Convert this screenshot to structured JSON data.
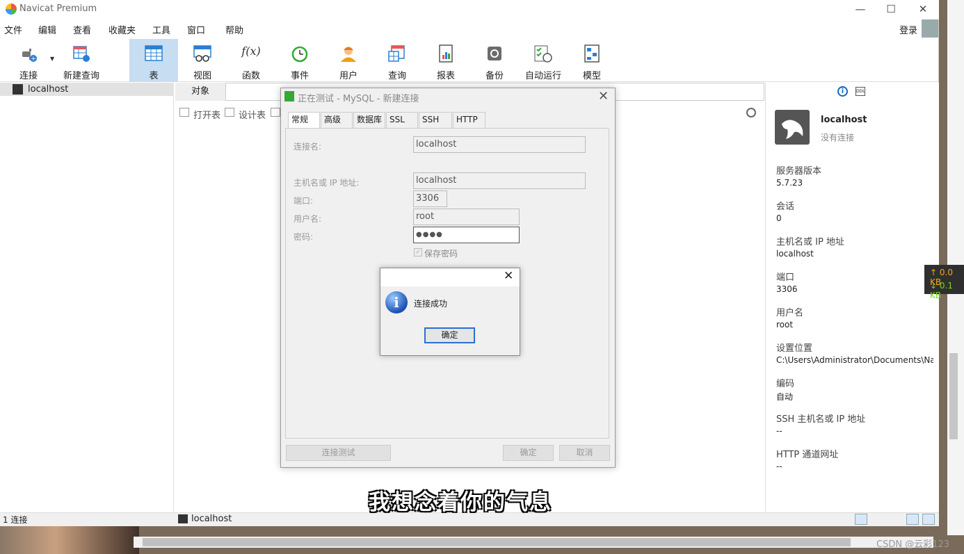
{
  "app": {
    "title": "Navicat Premium",
    "login": "登录"
  },
  "window_controls": {
    "minimize": "—",
    "maximize": "☐",
    "close": "✕"
  },
  "menu": [
    "文件",
    "编辑",
    "查看",
    "收藏夹",
    "工具",
    "窗口",
    "帮助"
  ],
  "toolbar": [
    {
      "label": "连接",
      "icon": "plug-icon"
    },
    {
      "label": "新建查询",
      "icon": "new-query-icon"
    },
    {
      "label": "表",
      "icon": "table-icon",
      "active": true
    },
    {
      "label": "视图",
      "icon": "view-icon"
    },
    {
      "label": "函数",
      "icon": "function-icon",
      "glyph": "f(x)"
    },
    {
      "label": "事件",
      "icon": "clock-icon"
    },
    {
      "label": "用户",
      "icon": "user-icon"
    },
    {
      "label": "查询",
      "icon": "query-icon"
    },
    {
      "label": "报表",
      "icon": "report-icon"
    },
    {
      "label": "备份",
      "icon": "backup-icon"
    },
    {
      "label": "自动运行",
      "icon": "schedule-icon"
    },
    {
      "label": "模型",
      "icon": "model-icon"
    }
  ],
  "tree": {
    "connection": "localhost"
  },
  "center": {
    "tab": "对象",
    "subtoolbar": [
      "打开表",
      "设计表"
    ]
  },
  "right_panel": {
    "name": "localhost",
    "status": "没有连接",
    "props": [
      {
        "label": "服务器版本",
        "value": "5.7.23"
      },
      {
        "label": "会话",
        "value": "0"
      },
      {
        "label": "主机名或 IP 地址",
        "value": "localhost"
      },
      {
        "label": "端口",
        "value": "3306"
      },
      {
        "label": "用户名",
        "value": "root"
      },
      {
        "label": "设置位置",
        "value": "C:\\Users\\Administrator\\Documents\\Na"
      },
      {
        "label": "编码",
        "value": "自动"
      },
      {
        "label": "SSH 主机名或 IP 地址",
        "value": "--"
      },
      {
        "label": "HTTP 通道网址",
        "value": "--"
      }
    ]
  },
  "status": {
    "left": "1 连接",
    "connection": "localhost"
  },
  "dialog": {
    "title": "正在测试 - MySQL - 新建连接",
    "tabs": [
      "常规",
      "高级",
      "数据库",
      "SSL",
      "SSH",
      "HTTP"
    ],
    "fields": {
      "conn_name_label": "连接名:",
      "conn_name": "localhost",
      "host_label": "主机名或 IP 地址:",
      "host": "localhost",
      "port_label": "端口:",
      "port": "3306",
      "user_label": "用户名:",
      "user": "root",
      "password_label": "密码:",
      "password": "●●●●"
    },
    "save_password": "保存密码",
    "buttons": {
      "test": "连接测试",
      "ok": "确定",
      "cancel": "取消"
    }
  },
  "message_box": {
    "text": "连接成功",
    "ok": "确定",
    "icon_glyph": "i"
  },
  "overlay": {
    "subtitle": "我想念着你的气息",
    "net_up": "↑ 0.0 KB",
    "net_down": "↓ 0.1 KB",
    "watermark": "CSDN @云彩123"
  }
}
